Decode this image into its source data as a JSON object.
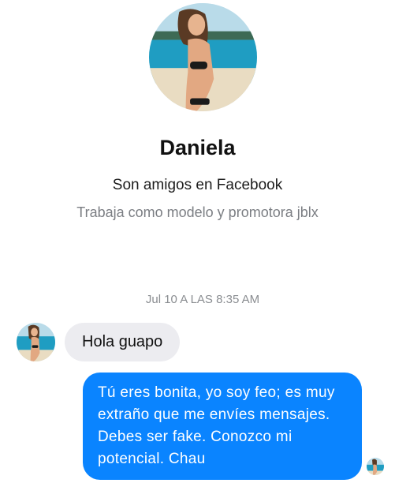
{
  "profile": {
    "name": "Daniela",
    "relationship": "Son amigos en Facebook",
    "work": "Trabaja como modelo y promotora jblx"
  },
  "conversation": {
    "timestamp": "Jul 10 A LAS 8:35 AM",
    "messages": [
      {
        "direction": "incoming",
        "text": "Hola guapo"
      },
      {
        "direction": "outgoing",
        "text": "Tú eres bonita, yo soy feo; es muy extraño que me envíes mensajes. Debes ser fake. Conozco mi potencial. Chau"
      }
    ]
  },
  "colors": {
    "outgoing_bubble": "#0a84ff",
    "incoming_bubble": "#ececf0",
    "timestamp_text": "#8a8d91"
  }
}
